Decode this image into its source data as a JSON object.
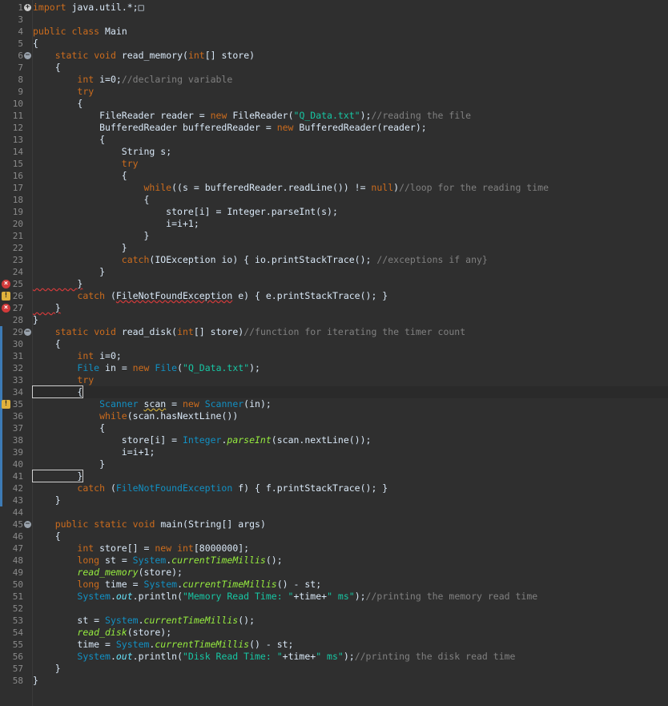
{
  "editor": {
    "lines": [
      {
        "n": "1",
        "t": "import java.util.*;□"
      },
      {
        "n": "3",
        "t": ""
      },
      {
        "n": "4",
        "t": "public class Main"
      },
      {
        "n": "5",
        "t": "{"
      },
      {
        "n": "6",
        "t": "    static void read_memory(int[] store)"
      },
      {
        "n": "7",
        "t": "    {"
      },
      {
        "n": "8",
        "t": "        int i=0;//declaring variable"
      },
      {
        "n": "9",
        "t": "        try"
      },
      {
        "n": "10",
        "t": "        {"
      },
      {
        "n": "11",
        "t": "            FileReader reader = new FileReader(\"Q_Data.txt\");//reading the file"
      },
      {
        "n": "12",
        "t": "            BufferedReader bufferedReader = new BufferedReader(reader);"
      },
      {
        "n": "13",
        "t": "            {"
      },
      {
        "n": "14",
        "t": "                String s;"
      },
      {
        "n": "15",
        "t": "                try"
      },
      {
        "n": "16",
        "t": "                {"
      },
      {
        "n": "17",
        "t": "                    while((s = bufferedReader.readLine()) != null)//loop for the reading time"
      },
      {
        "n": "18",
        "t": "                    {"
      },
      {
        "n": "19",
        "t": "                        store[i] = Integer.parseInt(s);"
      },
      {
        "n": "20",
        "t": "                        i=i+1;"
      },
      {
        "n": "21",
        "t": "                    }"
      },
      {
        "n": "22",
        "t": "                }"
      },
      {
        "n": "23",
        "t": "                catch(IOException io) { io.printStackTrace(); //exceptions if any}"
      },
      {
        "n": "24",
        "t": "            }"
      },
      {
        "n": "25",
        "t": "        }"
      },
      {
        "n": "26",
        "t": "        catch (FileNotFoundException e) { e.printStackTrace(); }"
      },
      {
        "n": "27",
        "t": "    }"
      },
      {
        "n": "28",
        "t": "}"
      },
      {
        "n": "29",
        "t": "    static void read_disk(int[] store)//function for iterating the timer count"
      },
      {
        "n": "30",
        "t": "    {"
      },
      {
        "n": "31",
        "t": "        int i=0;"
      },
      {
        "n": "32",
        "t": "        File in = new File(\"Q_Data.txt\");"
      },
      {
        "n": "33",
        "t": "        try"
      },
      {
        "n": "34",
        "t": "        {"
      },
      {
        "n": "35",
        "t": "            Scanner scan = new Scanner(in);"
      },
      {
        "n": "36",
        "t": "            while(scan.hasNextLine())"
      },
      {
        "n": "37",
        "t": "            {"
      },
      {
        "n": "38",
        "t": "                store[i] = Integer.parseInt(scan.nextLine());"
      },
      {
        "n": "39",
        "t": "                i=i+1;"
      },
      {
        "n": "40",
        "t": "            }"
      },
      {
        "n": "41",
        "t": "        }"
      },
      {
        "n": "42",
        "t": "        catch (FileNotFoundException f) { f.printStackTrace(); }"
      },
      {
        "n": "43",
        "t": "    }"
      },
      {
        "n": "44",
        "t": ""
      },
      {
        "n": "45",
        "t": "    public static void main(String[] args)"
      },
      {
        "n": "46",
        "t": "    {"
      },
      {
        "n": "47",
        "t": "        int store[] = new int[8000000];"
      },
      {
        "n": "48",
        "t": "        long st = System.currentTimeMillis();"
      },
      {
        "n": "49",
        "t": "        read_memory(store);"
      },
      {
        "n": "50",
        "t": "        long time = System.currentTimeMillis() - st;"
      },
      {
        "n": "51",
        "t": "        System.out.println(\"Memory Read Time: \"+time+\" ms\");//printing the memory read time"
      },
      {
        "n": "52",
        "t": ""
      },
      {
        "n": "53",
        "t": "        st = System.currentTimeMillis();"
      },
      {
        "n": "54",
        "t": "        read_disk(store);"
      },
      {
        "n": "55",
        "t": "        time = System.currentTimeMillis() - st;"
      },
      {
        "n": "56",
        "t": "        System.out.println(\"Disk Read Time: \"+time+\" ms\");//printing the disk read time"
      },
      {
        "n": "57",
        "t": "    }"
      },
      {
        "n": "58",
        "t": "}"
      }
    ]
  }
}
